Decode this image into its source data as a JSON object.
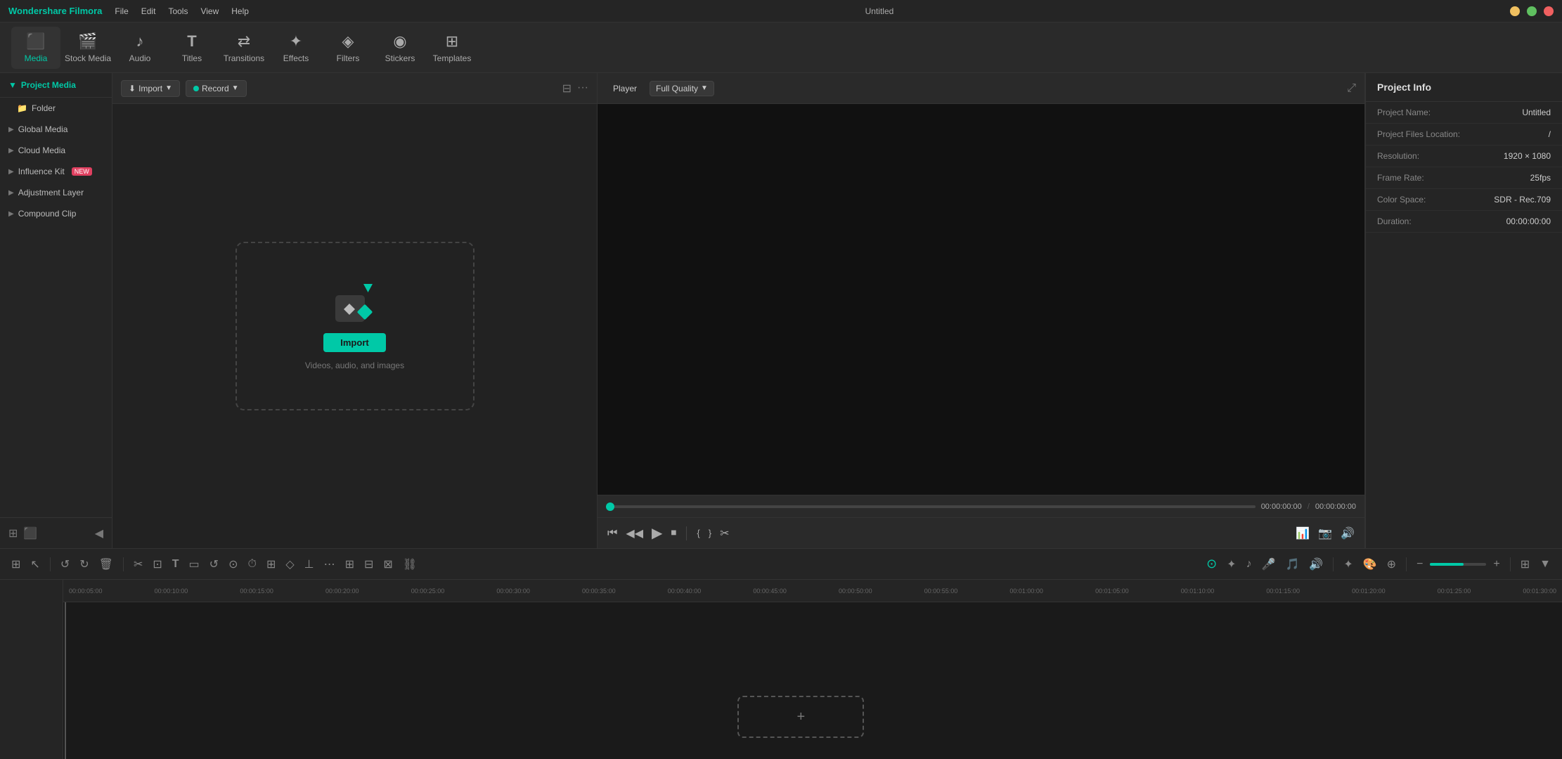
{
  "app": {
    "name": "Wondershare Filmora",
    "title": "Untitled"
  },
  "titlebar": {
    "menus": [
      "File",
      "Edit",
      "Tools",
      "View",
      "Help"
    ],
    "controls": {
      "min": "minimize",
      "max": "maximize",
      "close": "close"
    }
  },
  "toolbar": {
    "items": [
      {
        "id": "media",
        "label": "Media",
        "icon": "⬛",
        "active": true
      },
      {
        "id": "stock-media",
        "label": "Stock Media",
        "icon": "🎬"
      },
      {
        "id": "audio",
        "label": "Audio",
        "icon": "♪"
      },
      {
        "id": "titles",
        "label": "Titles",
        "icon": "T"
      },
      {
        "id": "transitions",
        "label": "Transitions",
        "icon": "⇄"
      },
      {
        "id": "effects",
        "label": "Effects",
        "icon": "✦"
      },
      {
        "id": "filters",
        "label": "Filters",
        "icon": "◈"
      },
      {
        "id": "stickers",
        "label": "Stickers",
        "icon": "◉"
      },
      {
        "id": "templates",
        "label": "Templates",
        "icon": "⊞"
      }
    ]
  },
  "sidebar": {
    "header": "Project Media",
    "items": [
      {
        "id": "folder",
        "label": "Folder",
        "indent": true
      },
      {
        "id": "global-media",
        "label": "Global Media",
        "chevron": true
      },
      {
        "id": "cloud-media",
        "label": "Cloud Media",
        "chevron": true
      },
      {
        "id": "influence-kit",
        "label": "Influence Kit",
        "badge": "NEW",
        "chevron": true
      },
      {
        "id": "adjustment-layer",
        "label": "Adjustment Layer",
        "chevron": true
      },
      {
        "id": "compound-clip",
        "label": "Compound Clip",
        "chevron": true
      }
    ]
  },
  "media_panel": {
    "import_button": "Import",
    "record_button": "Record",
    "import_zone": {
      "button_label": "Import",
      "hint": "Videos, audio, and images"
    }
  },
  "player": {
    "tab_label": "Player",
    "quality": "Full Quality",
    "time_current": "00:00:00:00",
    "time_total": "00:00:00:00",
    "controls": {
      "prev": "⏮",
      "rewind": "◀",
      "play": "▶",
      "stop": "⏹"
    }
  },
  "project_info": {
    "title": "Project Info",
    "fields": [
      {
        "label": "Project Name:",
        "value": "Untitled"
      },
      {
        "label": "Project Files Location:",
        "value": "/"
      },
      {
        "label": "Resolution:",
        "value": "1920 × 1080"
      },
      {
        "label": "Frame Rate:",
        "value": "25fps"
      },
      {
        "label": "Color Space:",
        "value": "SDR - Rec.709"
      },
      {
        "label": "Duration:",
        "value": "00:00:00:00"
      }
    ]
  },
  "timeline": {
    "ruler_marks": [
      "00:00:05:00",
      "00:00:10:00",
      "00:00:15:00",
      "00:00:20:00",
      "00:00:25:00",
      "00:00:30:00",
      "00:00:35:00",
      "00:00:40:00",
      "00:00:45:00",
      "00:00:50:00",
      "00:00:55:00",
      "00:01:00:00",
      "00:01:05:00",
      "00:01:10:00",
      "00:01:15:00",
      "00:01:20:00",
      "00:01:25:00",
      "00:01:30:00"
    ]
  },
  "colors": {
    "accent": "#00c9a7",
    "bg_dark": "#1a1a1a",
    "bg_medium": "#252525",
    "bg_light": "#2a2a2a",
    "border": "#333",
    "text_primary": "#ddd",
    "text_secondary": "#aaa",
    "text_muted": "#777"
  }
}
